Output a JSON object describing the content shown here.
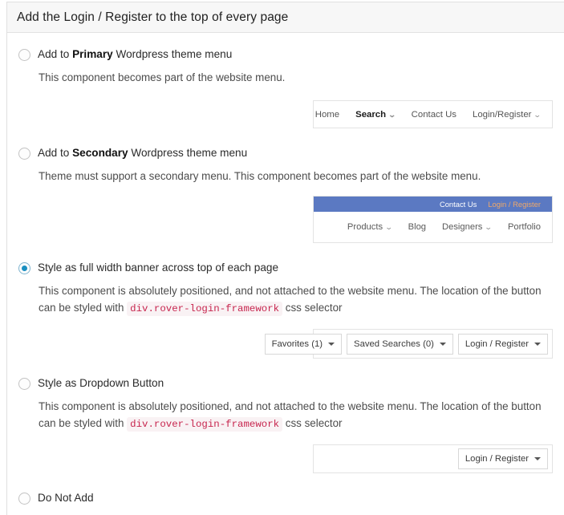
{
  "panel": {
    "title": "Add the Login / Register to the top of every page"
  },
  "options": [
    {
      "id": "primary-menu",
      "checked": false,
      "label_prefix": "Add to ",
      "label_bold": "Primary",
      "label_suffix": " Wordpress theme menu",
      "description": "This component becomes part of the website menu."
    },
    {
      "id": "secondary-menu",
      "checked": false,
      "label_prefix": "Add to ",
      "label_bold": "Secondary",
      "label_suffix": " Wordpress theme menu",
      "description": "Theme must support a secondary menu. This component becomes part of the website menu."
    },
    {
      "id": "full-width-banner",
      "checked": true,
      "label": "Style as full width banner across top of each page",
      "desc_part1": "This component is absolutely positioned, and not attached to the website menu. The location of the button can be styled with ",
      "desc_code": "div.rover-login-framework",
      "desc_part2": " css selector"
    },
    {
      "id": "dropdown-button",
      "checked": false,
      "label": "Style as Dropdown Button",
      "desc_part1": "This component is absolutely positioned, and not attached to the website menu. The location of the button can be styled with ",
      "desc_code": "div.rover-login-framework",
      "desc_part2": " css selector"
    },
    {
      "id": "do-not-add",
      "checked": false,
      "label": "Do Not Add"
    }
  ],
  "preview_primary": {
    "items": [
      {
        "label": "Home",
        "bold": false,
        "caret": false
      },
      {
        "label": "Search",
        "bold": true,
        "caret": true
      },
      {
        "label": "Contact Us",
        "bold": false,
        "caret": false
      },
      {
        "label": "Login/Register",
        "bold": false,
        "caret": true
      }
    ],
    "chevron": "⌄"
  },
  "preview_secondary": {
    "bar_color": "#5b79c2",
    "top_items": [
      {
        "label": "Contact Us",
        "color": "#ffffff"
      },
      {
        "label": "Login / Register",
        "color": "#f0a868"
      }
    ],
    "bottom_items": [
      {
        "label": "Products",
        "caret": true
      },
      {
        "label": "Blog",
        "caret": false
      },
      {
        "label": "Designers",
        "caret": true
      },
      {
        "label": "Portfolio",
        "caret": false
      }
    ],
    "chevron": "⌄"
  },
  "preview_banner": {
    "buttons": [
      {
        "label": "Favorites (1)"
      },
      {
        "label": "Saved Searches (0)"
      },
      {
        "label": "Login / Register"
      }
    ]
  },
  "preview_dropdown": {
    "buttons": [
      {
        "label": "Login / Register"
      }
    ]
  }
}
